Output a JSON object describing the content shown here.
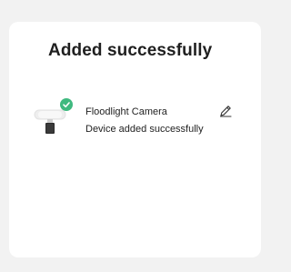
{
  "dialog": {
    "title": "Added successfully"
  },
  "device": {
    "name": "Floodlight Camera",
    "status": "Device added successfully",
    "icon": "floodlight-camera-icon",
    "badge_icon": "check-icon",
    "edit_icon": "pencil-icon"
  },
  "colors": {
    "background": "#f2f2f2",
    "card": "#ffffff",
    "success": "#3fb97f",
    "text": "#1f1f1f"
  }
}
